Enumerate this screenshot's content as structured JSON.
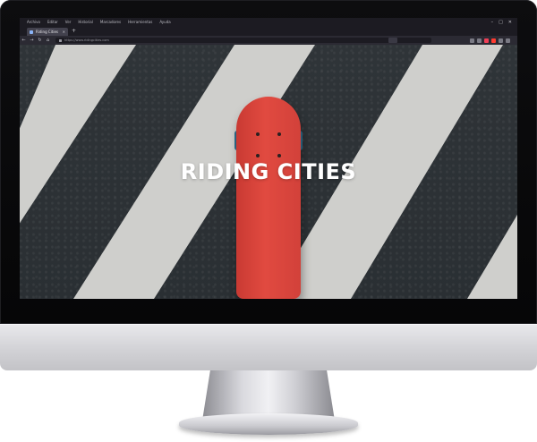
{
  "browser": {
    "menu": [
      "Archivo",
      "Editar",
      "Ver",
      "Historial",
      "Marcadores",
      "Herramientas",
      "Ayuda"
    ],
    "tab_title": "Riding Cities",
    "url": "https://www.ridingcities.com",
    "accent": "#ff3b30"
  },
  "hero": {
    "title": "RIDING CITIES",
    "board_color": "#d9443b",
    "stripe_color": "#cfcfcc",
    "asphalt_color": "#2d3236"
  }
}
